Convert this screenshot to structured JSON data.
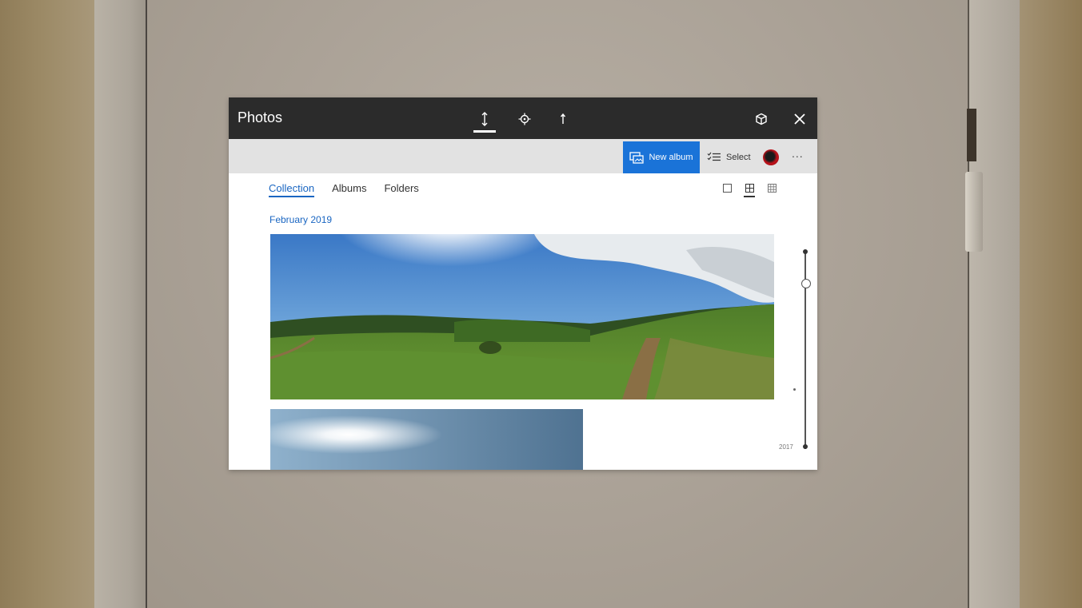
{
  "window": {
    "title": "Photos"
  },
  "titlebar": {
    "buttons": [
      {
        "icon": "adjust-height-icon",
        "active": true
      },
      {
        "icon": "move-icon",
        "active": false
      },
      {
        "icon": "resize-icon",
        "active": false
      },
      {
        "icon": "3d-box-icon"
      },
      {
        "icon": "close-icon"
      }
    ]
  },
  "commandbar": {
    "new_album_label": "New album",
    "select_label": "Select",
    "more_label": "..."
  },
  "nav": {
    "tabs": [
      {
        "label": "Collection",
        "active": true
      },
      {
        "label": "Albums",
        "active": false
      },
      {
        "label": "Folders",
        "active": false
      }
    ]
  },
  "view_toggles": [
    "single-view-icon",
    "medium-grid-icon",
    "small-grid-icon"
  ],
  "content": {
    "date_header": "February 2019"
  },
  "timeline": {
    "year_label": "2017"
  },
  "colors": {
    "accent": "#1a73d8",
    "titlebar": "#2b2b2b",
    "commandbar": "#e2e2e2"
  }
}
